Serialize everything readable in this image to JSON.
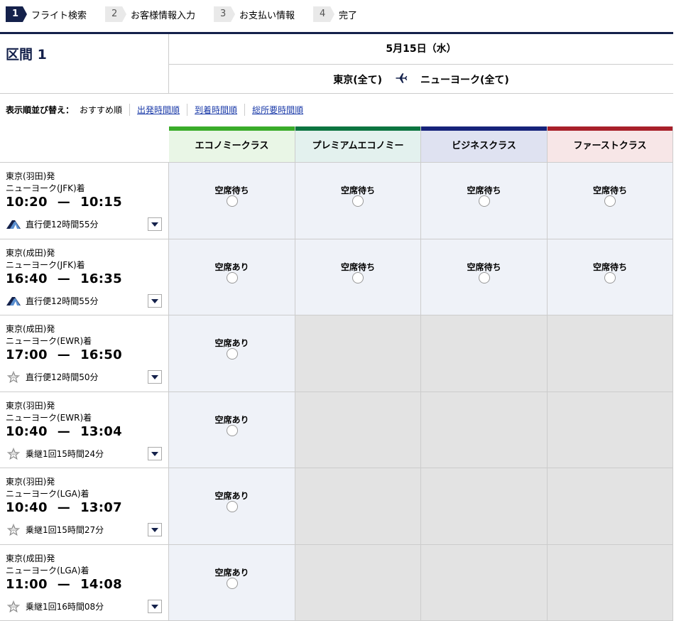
{
  "steps": [
    {
      "num": "1",
      "label": "フライト検索",
      "active": true
    },
    {
      "num": "2",
      "label": "お客様情報入力",
      "active": false
    },
    {
      "num": "3",
      "label": "お支払い情報",
      "active": false
    },
    {
      "num": "4",
      "label": "完了",
      "active": false
    }
  ],
  "section": {
    "title": "区間 1",
    "date": "5月15日（水）",
    "from": "東京(全て)",
    "to": "ニューヨーク(全て)"
  },
  "sort": {
    "label": "表示順並び替え：",
    "current": "おすすめ順",
    "links": [
      "出発時間順",
      "到着時間順",
      "総所要時間順"
    ]
  },
  "classes": [
    {
      "name": "エコノミークラス",
      "bar": "#3aac2a",
      "bg": "#e9f6e6"
    },
    {
      "name": "プレミアムエコノミー",
      "bar": "#0c7440",
      "bg": "#e3f1ee"
    },
    {
      "name": "ビジネスクラス",
      "bar": "#16237a",
      "bg": "#dfe2f1"
    },
    {
      "name": "ファーストクラス",
      "bar": "#a8202a",
      "bg": "#f7e6e7"
    }
  ],
  "flights": [
    {
      "from": "東京(羽田)発",
      "to": "ニューヨーク(JFK)着",
      "dep": "10:20",
      "arr": "10:15",
      "info": "直行便12時間55分",
      "airline": "ana-logo-icon",
      "seats": [
        "空席待ち",
        "空席待ち",
        "空席待ち",
        "空席待ち"
      ]
    },
    {
      "from": "東京(成田)発",
      "to": "ニューヨーク(JFK)着",
      "dep": "16:40",
      "arr": "16:35",
      "info": "直行便12時間55分",
      "airline": "ana-logo-icon",
      "seats": [
        "空席あり",
        "空席待ち",
        "空席待ち",
        "空席待ち"
      ]
    },
    {
      "from": "東京(成田)発",
      "to": "ニューヨーク(EWR)着",
      "dep": "17:00",
      "arr": "16:50",
      "info": "直行便12時間50分",
      "airline": "star-alliance-icon",
      "seats": [
        "空席あり",
        null,
        null,
        null
      ]
    },
    {
      "from": "東京(羽田)発",
      "to": "ニューヨーク(EWR)着",
      "dep": "10:40",
      "arr": "13:04",
      "info": "乗継1回15時間24分",
      "airline": "star-alliance-icon",
      "seats": [
        "空席あり",
        null,
        null,
        null
      ]
    },
    {
      "from": "東京(羽田)発",
      "to": "ニューヨーク(LGA)着",
      "dep": "10:40",
      "arr": "13:07",
      "info": "乗継1回15時間27分",
      "airline": "star-alliance-icon",
      "seats": [
        "空席あり",
        null,
        null,
        null
      ]
    },
    {
      "from": "東京(成田)発",
      "to": "ニューヨーク(LGA)着",
      "dep": "11:00",
      "arr": "14:08",
      "info": "乗継1回16時間08分",
      "airline": "star-alliance-icon",
      "seats": [
        "空席あり",
        null,
        null,
        null
      ]
    }
  ],
  "time_separator": "—",
  "colors": {
    "navy": "#14214b",
    "link": "#1a3aa8",
    "available_bg": "#eff2f8",
    "unavailable_bg": "#e3e3e3"
  }
}
